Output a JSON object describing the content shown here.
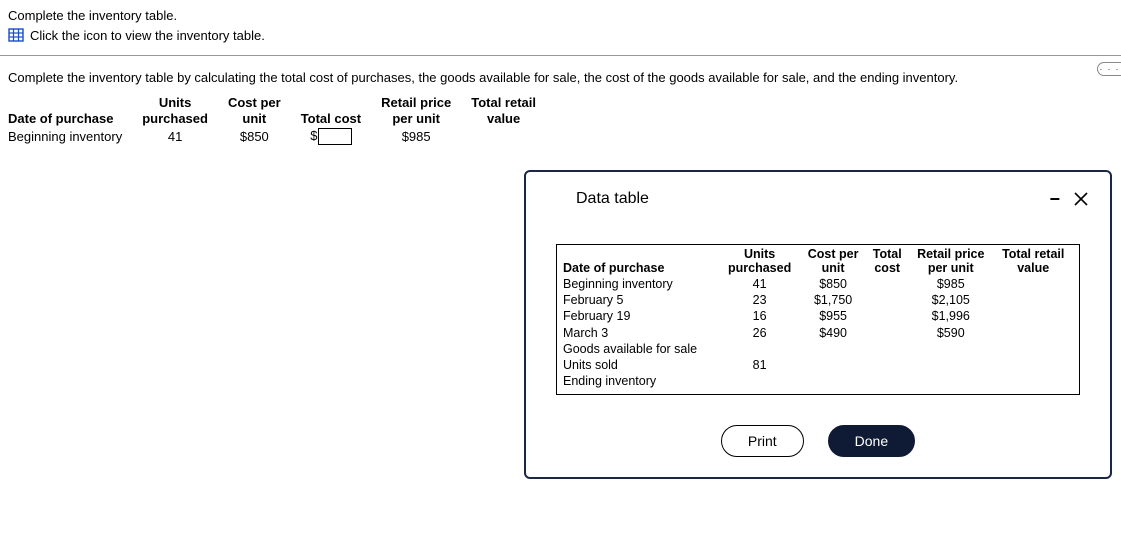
{
  "instructions": {
    "line1": "Complete the inventory table.",
    "line2": "Click the icon to view the inventory table."
  },
  "subtitle": "Complete the inventory table by calculating the total cost of purchases, the goods available for sale, the cost of the goods available for sale, and the ending inventory.",
  "work_table": {
    "headers": {
      "date": "Date of purchase",
      "units_l1": "Units",
      "units_l2": "purchased",
      "cost_l1": "Cost per",
      "cost_l2": "unit",
      "total_cost": "Total cost",
      "retail_l1": "Retail price",
      "retail_l2": "per unit",
      "trv_l1": "Total retail",
      "trv_l2": "value"
    },
    "row": {
      "label": "Beginning inventory",
      "units": "41",
      "cost_per_unit": "$850",
      "currency_prefix": "$",
      "retail_per_unit": "$985"
    }
  },
  "modal": {
    "title": "Data table",
    "headers": {
      "date": "Date of purchase",
      "units_l1": "Units",
      "units_l2": "purchased",
      "cost_l1": "Cost per",
      "cost_l2": "unit",
      "tc_l1": "Total",
      "tc_l2": "cost",
      "retail_l1": "Retail price",
      "retail_l2": "per unit",
      "trv_l1": "Total retail",
      "trv_l2": "value"
    },
    "rows": [
      {
        "date": "Beginning inventory",
        "units": "41",
        "cpu": "$850",
        "tc": "",
        "rpu": "$985",
        "trv": ""
      },
      {
        "date": "February 5",
        "units": "23",
        "cpu": "$1,750",
        "tc": "",
        "rpu": "$2,105",
        "trv": ""
      },
      {
        "date": "February 19",
        "units": "16",
        "cpu": "$955",
        "tc": "",
        "rpu": "$1,996",
        "trv": ""
      },
      {
        "date": "March 3",
        "units": "26",
        "cpu": "$490",
        "tc": "",
        "rpu": "$590",
        "trv": ""
      },
      {
        "date": "Goods available for sale",
        "units": "",
        "cpu": "",
        "tc": "",
        "rpu": "",
        "trv": ""
      },
      {
        "date": "Units sold",
        "units": "81",
        "cpu": "",
        "tc": "",
        "rpu": "",
        "trv": ""
      },
      {
        "date": "Ending inventory",
        "units": "",
        "cpu": "",
        "tc": "",
        "rpu": "",
        "trv": ""
      }
    ],
    "buttons": {
      "print": "Print",
      "done": "Done"
    }
  },
  "overflow_label": "· · ·"
}
